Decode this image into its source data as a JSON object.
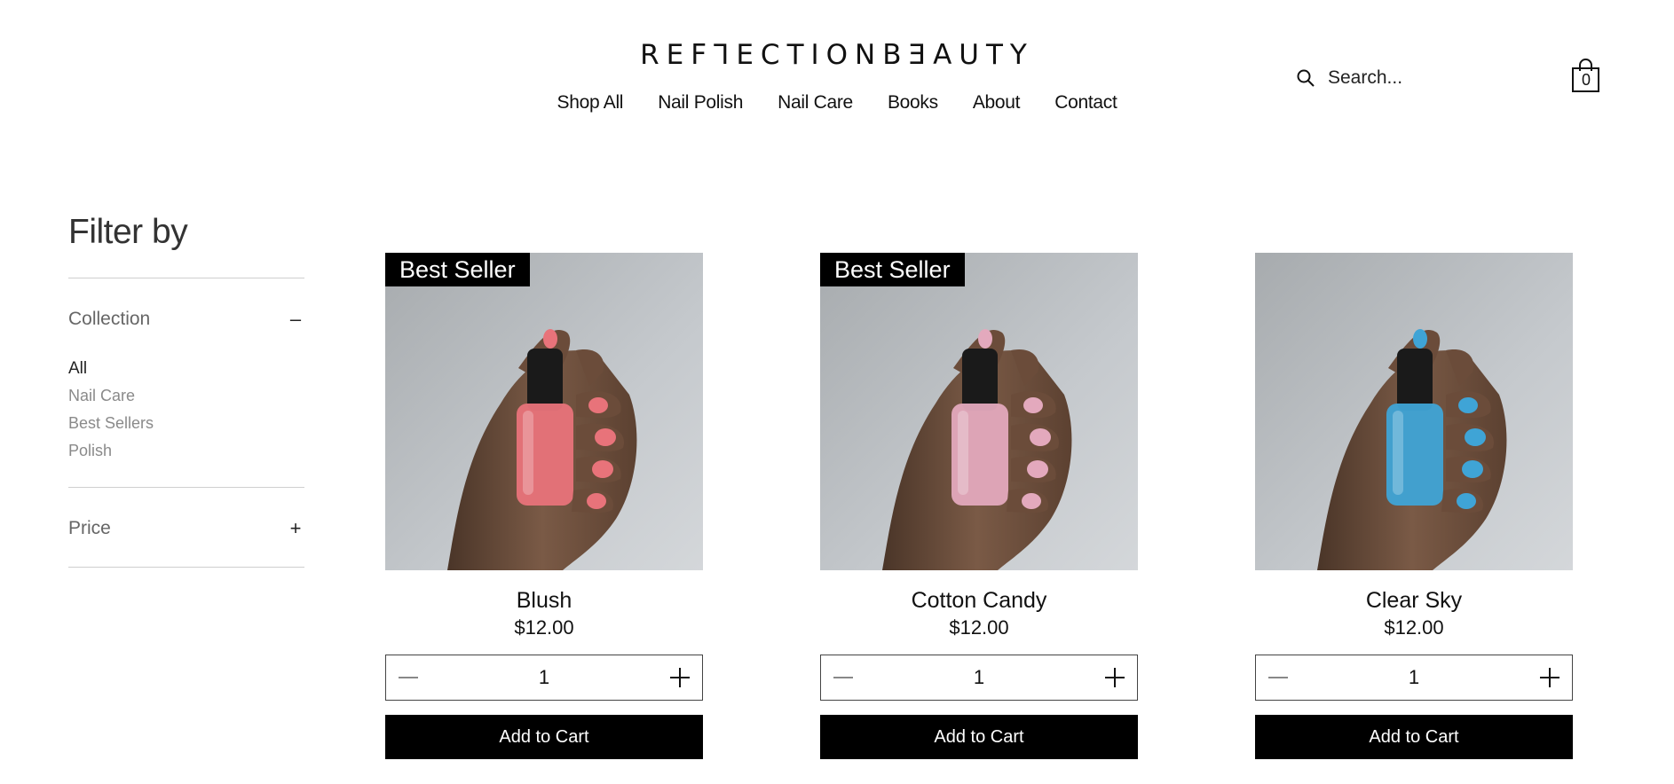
{
  "brand": {
    "logo_text": "REFꓶECTIONBƎAUTY"
  },
  "nav": {
    "items": [
      "Shop All",
      "Nail Polish",
      "Nail Care",
      "Books",
      "About",
      "Contact"
    ]
  },
  "search": {
    "placeholder": "Search..."
  },
  "cart": {
    "count": "0"
  },
  "filter": {
    "title": "Filter by",
    "collection": {
      "label": "Collection",
      "toggle": "–",
      "options": [
        "All",
        "Nail Care",
        "Best Sellers",
        "Polish"
      ],
      "selected": "All"
    },
    "price": {
      "label": "Price",
      "toggle": "+"
    }
  },
  "products": [
    {
      "badge": "Best Seller",
      "name": "Blush",
      "price": "$12.00",
      "qty": "1",
      "add_label": "Add to Cart",
      "polish_color": "#e8737a"
    },
    {
      "badge": "Best Seller",
      "name": "Cotton Candy",
      "price": "$12.00",
      "qty": "1",
      "add_label": "Add to Cart",
      "polish_color": "#e3a9bd"
    },
    {
      "badge": "",
      "name": "Clear Sky",
      "price": "$12.00",
      "qty": "1",
      "add_label": "Add to Cart",
      "polish_color": "#3fa4d6"
    }
  ]
}
